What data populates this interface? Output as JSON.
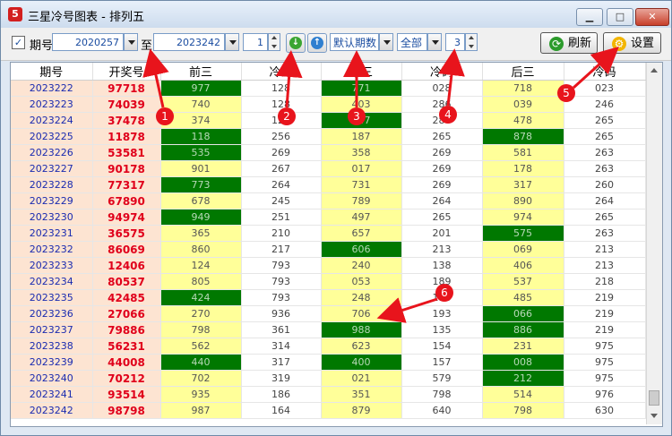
{
  "window": {
    "app_icon": "lottery-icon",
    "title": "三星冷号图表 - 排列五"
  },
  "toolbar": {
    "period_checkbox_checked": "✓",
    "period_label": "期号",
    "from_value": "2020257",
    "to_label": "至",
    "to_value": "2023242",
    "spin1_value": "1",
    "mode_value": "默认期数",
    "filter_value": "全部",
    "spin2_value": "3",
    "refresh_label": "刷新",
    "settings_label": "设置"
  },
  "columns": [
    "期号",
    "开奖号",
    "前三",
    "冷码",
    "中三",
    "冷码",
    "后三",
    "冷码"
  ],
  "rows": [
    {
      "period": "2023222",
      "draw": "97718",
      "front": "977",
      "fc": "128",
      "mid": "771",
      "mc": "028",
      "back": "718",
      "bc": "023",
      "fg": 1,
      "mg": 1,
      "bg": 0
    },
    {
      "period": "2023223",
      "draw": "74039",
      "front": "740",
      "fc": "128",
      "mid": "403",
      "mc": "286",
      "back": "039",
      "bc": "246",
      "fg": 0,
      "mg": 0,
      "bg": 0
    },
    {
      "period": "2023224",
      "draw": "37478",
      "front": "374",
      "fc": "128",
      "mid": "747",
      "mc": "280",
      "back": "478",
      "bc": "265",
      "fg": 0,
      "mg": 1,
      "bg": 0
    },
    {
      "period": "2023225",
      "draw": "11878",
      "front": "118",
      "fc": "256",
      "mid": "187",
      "mc": "265",
      "back": "878",
      "bc": "265",
      "fg": 1,
      "mg": 0,
      "bg": 1
    },
    {
      "period": "2023226",
      "draw": "53581",
      "front": "535",
      "fc": "269",
      "mid": "358",
      "mc": "269",
      "back": "581",
      "bc": "263",
      "fg": 1,
      "mg": 0,
      "bg": 0
    },
    {
      "period": "2023227",
      "draw": "90178",
      "front": "901",
      "fc": "267",
      "mid": "017",
      "mc": "269",
      "back": "178",
      "bc": "263",
      "fg": 0,
      "mg": 0,
      "bg": 0
    },
    {
      "period": "2023228",
      "draw": "77317",
      "front": "773",
      "fc": "264",
      "mid": "731",
      "mc": "269",
      "back": "317",
      "bc": "260",
      "fg": 1,
      "mg": 0,
      "bg": 0
    },
    {
      "period": "2023229",
      "draw": "67890",
      "front": "678",
      "fc": "245",
      "mid": "789",
      "mc": "264",
      "back": "890",
      "bc": "264",
      "fg": 0,
      "mg": 0,
      "bg": 0
    },
    {
      "period": "2023230",
      "draw": "94974",
      "front": "949",
      "fc": "251",
      "mid": "497",
      "mc": "265",
      "back": "974",
      "bc": "265",
      "fg": 1,
      "mg": 0,
      "bg": 0
    },
    {
      "period": "2023231",
      "draw": "36575",
      "front": "365",
      "fc": "210",
      "mid": "657",
      "mc": "201",
      "back": "575",
      "bc": "263",
      "fg": 0,
      "mg": 0,
      "bg": 1
    },
    {
      "period": "2023232",
      "draw": "86069",
      "front": "860",
      "fc": "217",
      "mid": "606",
      "mc": "213",
      "back": "069",
      "bc": "213",
      "fg": 0,
      "mg": 1,
      "bg": 0
    },
    {
      "period": "2023233",
      "draw": "12406",
      "front": "124",
      "fc": "793",
      "mid": "240",
      "mc": "138",
      "back": "406",
      "bc": "213",
      "fg": 0,
      "mg": 0,
      "bg": 0
    },
    {
      "period": "2023234",
      "draw": "80537",
      "front": "805",
      "fc": "793",
      "mid": "053",
      "mc": "189",
      "back": "537",
      "bc": "218",
      "fg": 0,
      "mg": 0,
      "bg": 0
    },
    {
      "period": "2023235",
      "draw": "42485",
      "front": "424",
      "fc": "793",
      "mid": "248",
      "mc": "193",
      "back": "485",
      "bc": "219",
      "fg": 1,
      "mg": 0,
      "bg": 0
    },
    {
      "period": "2023236",
      "draw": "27066",
      "front": "270",
      "fc": "936",
      "mid": "706",
      "mc": "193",
      "back": "066",
      "bc": "219",
      "fg": 0,
      "mg": 0,
      "bg": 1
    },
    {
      "period": "2023237",
      "draw": "79886",
      "front": "798",
      "fc": "361",
      "mid": "988",
      "mc": "135",
      "back": "886",
      "bc": "219",
      "fg": 0,
      "mg": 1,
      "bg": 1
    },
    {
      "period": "2023238",
      "draw": "56231",
      "front": "562",
      "fc": "314",
      "mid": "623",
      "mc": "154",
      "back": "231",
      "bc": "975",
      "fg": 0,
      "mg": 0,
      "bg": 0
    },
    {
      "period": "2023239",
      "draw": "44008",
      "front": "440",
      "fc": "317",
      "mid": "400",
      "mc": "157",
      "back": "008",
      "bc": "975",
      "fg": 1,
      "mg": 1,
      "bg": 1
    },
    {
      "period": "2023240",
      "draw": "70212",
      "front": "702",
      "fc": "319",
      "mid": "021",
      "mc": "579",
      "back": "212",
      "bc": "975",
      "fg": 0,
      "mg": 0,
      "bg": 1
    },
    {
      "period": "2023241",
      "draw": "93514",
      "front": "935",
      "fc": "186",
      "mid": "351",
      "mc": "798",
      "back": "514",
      "bc": "976",
      "fg": 0,
      "mg": 0,
      "bg": 0
    },
    {
      "period": "2023242",
      "draw": "98798",
      "front": "987",
      "fc": "164",
      "mid": "879",
      "mc": "640",
      "back": "798",
      "bc": "630",
      "fg": 0,
      "mg": 0,
      "bg": 0
    }
  ],
  "annotations": [
    "1",
    "2",
    "3",
    "4",
    "5",
    "6"
  ],
  "colors": {
    "accent_red": "#e8141c",
    "hot_green": "#007800",
    "yellow": "#ffff99",
    "pink": "#fde4d2",
    "period_blue": "#1a2bb0"
  }
}
